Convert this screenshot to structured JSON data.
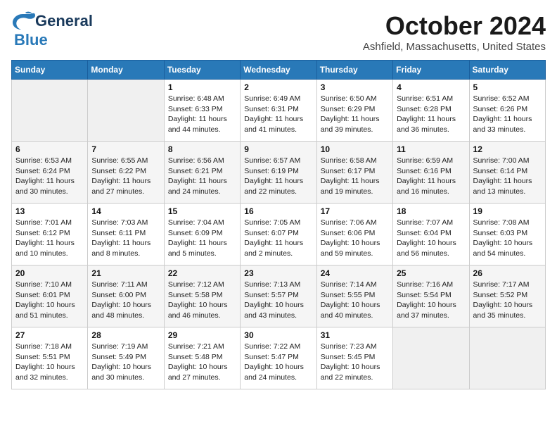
{
  "header": {
    "logo_line1": "General",
    "logo_line2": "Blue",
    "month": "October 2024",
    "location": "Ashfield, Massachusetts, United States"
  },
  "weekdays": [
    "Sunday",
    "Monday",
    "Tuesday",
    "Wednesday",
    "Thursday",
    "Friday",
    "Saturday"
  ],
  "weeks": [
    [
      {
        "day": "",
        "info": ""
      },
      {
        "day": "",
        "info": ""
      },
      {
        "day": "1",
        "info": "Sunrise: 6:48 AM\nSunset: 6:33 PM\nDaylight: 11 hours and 44 minutes."
      },
      {
        "day": "2",
        "info": "Sunrise: 6:49 AM\nSunset: 6:31 PM\nDaylight: 11 hours and 41 minutes."
      },
      {
        "day": "3",
        "info": "Sunrise: 6:50 AM\nSunset: 6:29 PM\nDaylight: 11 hours and 39 minutes."
      },
      {
        "day": "4",
        "info": "Sunrise: 6:51 AM\nSunset: 6:28 PM\nDaylight: 11 hours and 36 minutes."
      },
      {
        "day": "5",
        "info": "Sunrise: 6:52 AM\nSunset: 6:26 PM\nDaylight: 11 hours and 33 minutes."
      }
    ],
    [
      {
        "day": "6",
        "info": "Sunrise: 6:53 AM\nSunset: 6:24 PM\nDaylight: 11 hours and 30 minutes."
      },
      {
        "day": "7",
        "info": "Sunrise: 6:55 AM\nSunset: 6:22 PM\nDaylight: 11 hours and 27 minutes."
      },
      {
        "day": "8",
        "info": "Sunrise: 6:56 AM\nSunset: 6:21 PM\nDaylight: 11 hours and 24 minutes."
      },
      {
        "day": "9",
        "info": "Sunrise: 6:57 AM\nSunset: 6:19 PM\nDaylight: 11 hours and 22 minutes."
      },
      {
        "day": "10",
        "info": "Sunrise: 6:58 AM\nSunset: 6:17 PM\nDaylight: 11 hours and 19 minutes."
      },
      {
        "day": "11",
        "info": "Sunrise: 6:59 AM\nSunset: 6:16 PM\nDaylight: 11 hours and 16 minutes."
      },
      {
        "day": "12",
        "info": "Sunrise: 7:00 AM\nSunset: 6:14 PM\nDaylight: 11 hours and 13 minutes."
      }
    ],
    [
      {
        "day": "13",
        "info": "Sunrise: 7:01 AM\nSunset: 6:12 PM\nDaylight: 11 hours and 10 minutes."
      },
      {
        "day": "14",
        "info": "Sunrise: 7:03 AM\nSunset: 6:11 PM\nDaylight: 11 hours and 8 minutes."
      },
      {
        "day": "15",
        "info": "Sunrise: 7:04 AM\nSunset: 6:09 PM\nDaylight: 11 hours and 5 minutes."
      },
      {
        "day": "16",
        "info": "Sunrise: 7:05 AM\nSunset: 6:07 PM\nDaylight: 11 hours and 2 minutes."
      },
      {
        "day": "17",
        "info": "Sunrise: 7:06 AM\nSunset: 6:06 PM\nDaylight: 10 hours and 59 minutes."
      },
      {
        "day": "18",
        "info": "Sunrise: 7:07 AM\nSunset: 6:04 PM\nDaylight: 10 hours and 56 minutes."
      },
      {
        "day": "19",
        "info": "Sunrise: 7:08 AM\nSunset: 6:03 PM\nDaylight: 10 hours and 54 minutes."
      }
    ],
    [
      {
        "day": "20",
        "info": "Sunrise: 7:10 AM\nSunset: 6:01 PM\nDaylight: 10 hours and 51 minutes."
      },
      {
        "day": "21",
        "info": "Sunrise: 7:11 AM\nSunset: 6:00 PM\nDaylight: 10 hours and 48 minutes."
      },
      {
        "day": "22",
        "info": "Sunrise: 7:12 AM\nSunset: 5:58 PM\nDaylight: 10 hours and 46 minutes."
      },
      {
        "day": "23",
        "info": "Sunrise: 7:13 AM\nSunset: 5:57 PM\nDaylight: 10 hours and 43 minutes."
      },
      {
        "day": "24",
        "info": "Sunrise: 7:14 AM\nSunset: 5:55 PM\nDaylight: 10 hours and 40 minutes."
      },
      {
        "day": "25",
        "info": "Sunrise: 7:16 AM\nSunset: 5:54 PM\nDaylight: 10 hours and 37 minutes."
      },
      {
        "day": "26",
        "info": "Sunrise: 7:17 AM\nSunset: 5:52 PM\nDaylight: 10 hours and 35 minutes."
      }
    ],
    [
      {
        "day": "27",
        "info": "Sunrise: 7:18 AM\nSunset: 5:51 PM\nDaylight: 10 hours and 32 minutes."
      },
      {
        "day": "28",
        "info": "Sunrise: 7:19 AM\nSunset: 5:49 PM\nDaylight: 10 hours and 30 minutes."
      },
      {
        "day": "29",
        "info": "Sunrise: 7:21 AM\nSunset: 5:48 PM\nDaylight: 10 hours and 27 minutes."
      },
      {
        "day": "30",
        "info": "Sunrise: 7:22 AM\nSunset: 5:47 PM\nDaylight: 10 hours and 24 minutes."
      },
      {
        "day": "31",
        "info": "Sunrise: 7:23 AM\nSunset: 5:45 PM\nDaylight: 10 hours and 22 minutes."
      },
      {
        "day": "",
        "info": ""
      },
      {
        "day": "",
        "info": ""
      }
    ]
  ]
}
